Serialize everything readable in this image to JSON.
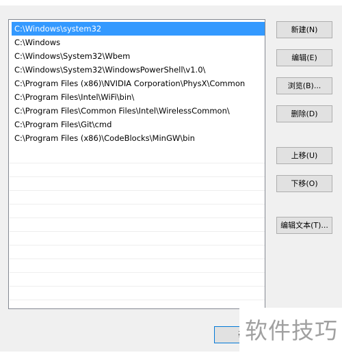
{
  "path_list": {
    "items": [
      "C:\\Windows\\system32",
      "C:\\Windows",
      "C:\\Windows\\System32\\Wbem",
      "C:\\Windows\\System32\\WindowsPowerShell\\v1.0\\",
      "C:\\Program Files (x86)\\NVIDIA Corporation\\PhysX\\Common",
      "C:\\Program Files\\Intel\\WiFi\\bin\\",
      "C:\\Program Files\\Common Files\\Intel\\WirelessCommon\\",
      "C:\\Program Files\\Git\\cmd",
      "C:\\Program Files (x86)\\CodeBlocks\\MinGW\\bin"
    ],
    "selected_index": 0
  },
  "buttons": {
    "new": "新建(N)",
    "edit": "编辑(E)",
    "browse": "浏览(B)...",
    "delete": "删除(D)",
    "move_up": "上移(U)",
    "move_down": "下移(O)",
    "edit_text": "编辑文本(T)..."
  },
  "footer": {
    "ok_label_partial": "确"
  },
  "watermark": {
    "text": "软件技巧"
  },
  "colors": {
    "selection": "#3399ff",
    "focus_border": "#0078d7"
  }
}
